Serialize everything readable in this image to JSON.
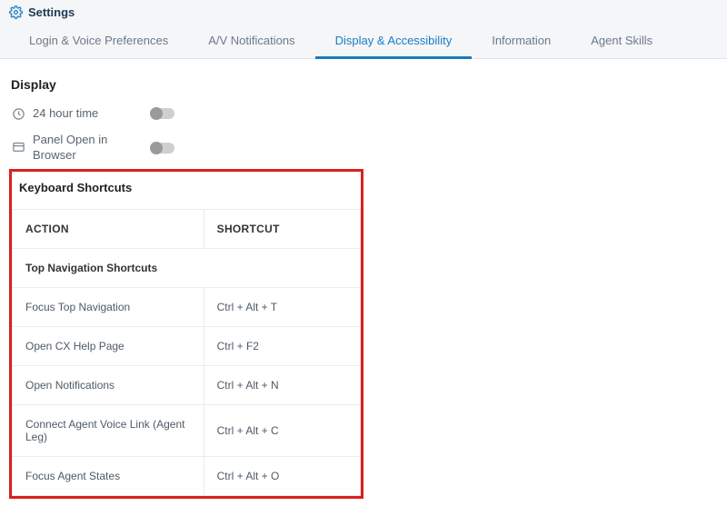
{
  "header": {
    "title": "Settings"
  },
  "tabs": [
    {
      "label": "Login & Voice Preferences",
      "active": false
    },
    {
      "label": "A/V Notifications",
      "active": false
    },
    {
      "label": "Display & Accessibility",
      "active": true
    },
    {
      "label": "Information",
      "active": false
    },
    {
      "label": "Agent Skills",
      "active": false
    }
  ],
  "display": {
    "title": "Display",
    "items": [
      {
        "label": "24 hour time",
        "icon": "clock-icon"
      },
      {
        "label": "Panel Open in Browser",
        "icon": "panel-icon"
      }
    ]
  },
  "keyboard": {
    "title": "Keyboard Shortcuts",
    "columns": {
      "action": "ACTION",
      "shortcut": "SHORTCUT"
    },
    "groupTitle": "Top Navigation Shortcuts",
    "rows": [
      {
        "action": "Focus Top Navigation",
        "shortcut": "Ctrl + Alt + T"
      },
      {
        "action": "Open CX Help Page",
        "shortcut": "Ctrl + F2"
      },
      {
        "action": "Open Notifications",
        "shortcut": "Ctrl + Alt + N"
      },
      {
        "action": "Connect Agent Voice Link (Agent Leg)",
        "shortcut": "Ctrl + Alt + C"
      },
      {
        "action": "Focus Agent States",
        "shortcut": "Ctrl + Alt + O"
      }
    ]
  }
}
